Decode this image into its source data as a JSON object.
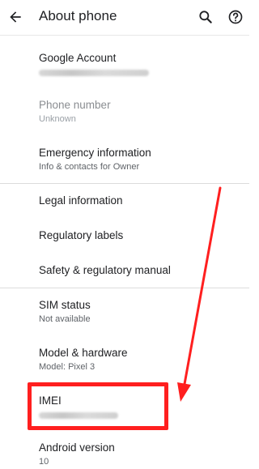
{
  "header": {
    "title": "About phone",
    "back_icon": "arrow-back-icon",
    "search_icon": "search-icon",
    "help_icon": "help-icon"
  },
  "items": [
    {
      "title": "Google Account",
      "subtitle_redacted": true
    },
    {
      "title": "Phone number",
      "subtitle": "Unknown"
    },
    {
      "title": "Emergency information",
      "subtitle": "Info & contacts for Owner"
    },
    {
      "title": "Legal information"
    },
    {
      "title": "Regulatory labels"
    },
    {
      "title": "Safety & regulatory manual"
    },
    {
      "title": "SIM status",
      "subtitle": "Not available"
    },
    {
      "title": "Model & hardware",
      "subtitle": "Model: Pixel 3"
    },
    {
      "title": "IMEI",
      "subtitle_redacted": true
    },
    {
      "title": "Android version",
      "subtitle": "10"
    }
  ],
  "annotation": {
    "highlight_color": "#ff1f1f",
    "target": "IMEI"
  }
}
